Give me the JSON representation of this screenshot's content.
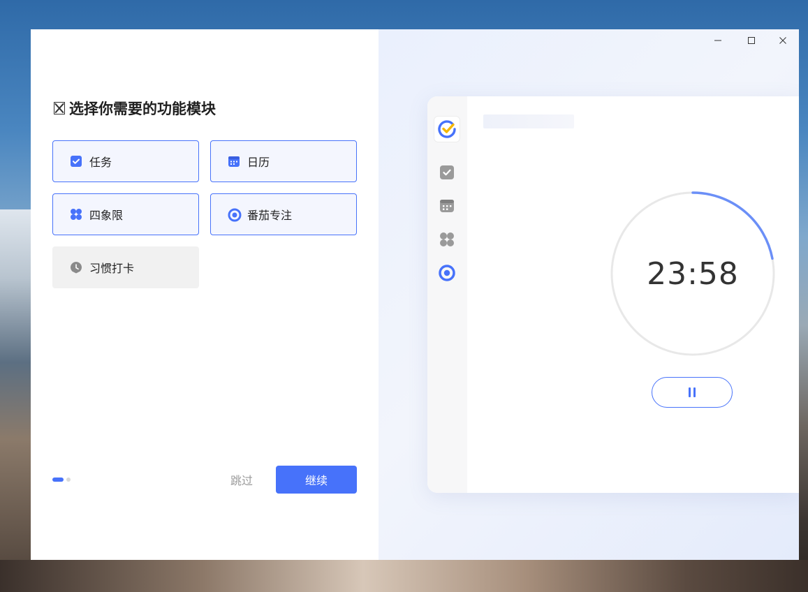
{
  "onboarding": {
    "heading": "选择你需要的功能模块",
    "modules": [
      {
        "label": "任务",
        "icon": "checkbox-icon",
        "selected": true
      },
      {
        "label": "日历",
        "icon": "calendar-icon",
        "selected": true
      },
      {
        "label": "四象限",
        "icon": "four-leaf-icon",
        "selected": true
      },
      {
        "label": "番茄专注",
        "icon": "pomodoro-icon",
        "selected": true
      },
      {
        "label": "习惯打卡",
        "icon": "habit-icon",
        "selected": false
      }
    ],
    "page_indicator": {
      "current": 1,
      "total": 2
    },
    "skip_label": "跳过",
    "continue_label": "继续"
  },
  "preview": {
    "timer": "23:58",
    "timer_progress": 0.22,
    "sidebar_icons": [
      "app-logo-icon",
      "task-icon",
      "calendar-icon",
      "four-leaf-icon",
      "pomodoro-icon"
    ],
    "active_sidebar": "pomodoro-icon"
  },
  "colors": {
    "accent": "#4772fa",
    "logo_yellow": "#f5b700",
    "ring_track": "#e8e8e8"
  }
}
